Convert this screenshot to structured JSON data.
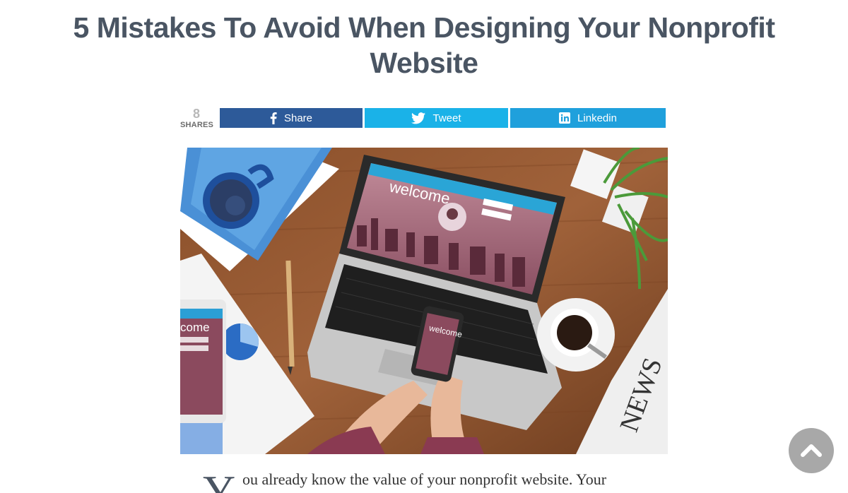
{
  "article": {
    "title": "5 Mistakes To Avoid When Designing Your Nonprofit Website",
    "intro_dropcap": "Y",
    "intro_text": "ou already know the value of your nonprofit website. Your"
  },
  "share_bar": {
    "count": "8",
    "count_label": "SHARES",
    "buttons": [
      {
        "label": "Share",
        "icon": "facebook-icon",
        "color": "#2d5a99"
      },
      {
        "label": "Tweet",
        "icon": "twitter-bird-icon",
        "color": "#1ab2e8"
      },
      {
        "label": "Linkedin",
        "icon": "linkedin-icon",
        "color": "#1fa0dc"
      }
    ]
  },
  "hero_image": {
    "screen_text": "welcome",
    "phone_text": "welcome",
    "tablet_text": "come",
    "newspaper_text": "NEWS"
  },
  "scroll_top": {
    "icon": "chevron-up-icon",
    "color": "#a8a8a8"
  }
}
